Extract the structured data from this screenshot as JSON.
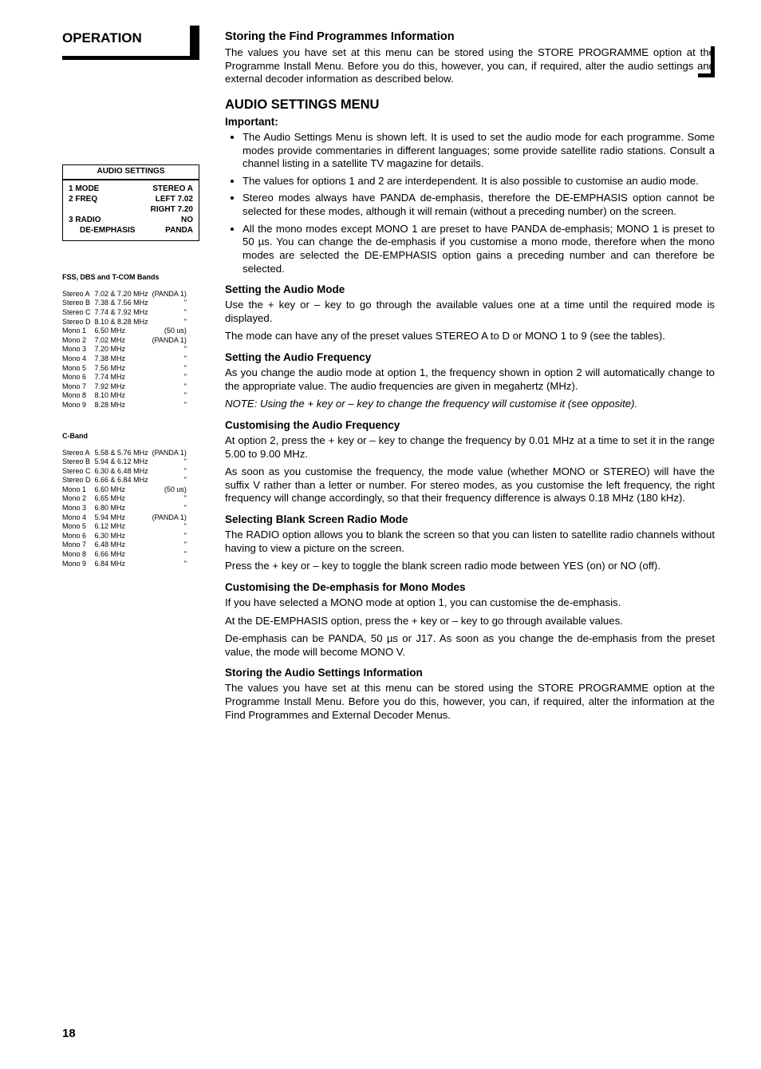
{
  "operation_title": "OPERATION",
  "menu_box": {
    "title": "AUDIO SETTINGS",
    "rows": [
      {
        "n": "1",
        "l": "MODE",
        "r": "STEREO A"
      },
      {
        "n": "2",
        "l": "FREQ",
        "r": "LEFT 7.02"
      },
      {
        "n": "",
        "l": "",
        "r": "RIGHT 7.20"
      },
      {
        "n": "3",
        "l": "RADIO",
        "r": "NO"
      },
      {
        "n": "",
        "l": "DE-EMPHASIS",
        "r": "PANDA",
        "indent": true
      }
    ]
  },
  "fss_head": "FSS, DBS and T-COM Bands",
  "fss_rows": [
    [
      "Stereo A",
      "7.02 & 7.20 MHz",
      "(PANDA 1)"
    ],
    [
      "Stereo B",
      "7.38 & 7.56 MHz",
      "\""
    ],
    [
      "Stereo C",
      "7.74 & 7.92 MHz",
      "\""
    ],
    [
      "Stereo D",
      "8.10 & 8.28 MHz",
      "\""
    ],
    [
      "Mono 1",
      "6.50 MHz",
      "(50 us)"
    ],
    [
      "Mono 2",
      "7.02 MHz",
      "(PANDA 1)"
    ],
    [
      "Mono 3",
      "7.20 MHz",
      "\""
    ],
    [
      "Mono 4",
      "7.38 MHz",
      "\""
    ],
    [
      "Mono 5",
      "7.56 MHz",
      "\""
    ],
    [
      "Mono 6",
      "7.74 MHz",
      "\""
    ],
    [
      "Mono 7",
      "7.92 MHz",
      "\""
    ],
    [
      "Mono 8",
      "8.10 MHz",
      "\""
    ],
    [
      "Mono 9",
      "8.28 MHz",
      "\""
    ]
  ],
  "cband_head": "C-Band",
  "cband_rows": [
    [
      "Stereo A",
      "5.58 & 5.76 MHz",
      "(PANDA 1)"
    ],
    [
      "Stereo B",
      "5.94 & 6.12 MHz",
      "\""
    ],
    [
      "Stereo C",
      "6.30 & 6.48 MHz",
      "\""
    ],
    [
      "Stereo D",
      "6.66 & 6.84 MHz",
      "\""
    ],
    [
      "Mono 1",
      "6.60 MHz",
      "(50 us)"
    ],
    [
      "Mono 2",
      "6.65 MHz",
      "\""
    ],
    [
      "Mono 3",
      "6.80 MHz",
      "\""
    ],
    [
      "Mono 4",
      "5.94 MHz",
      "(PANDA 1)"
    ],
    [
      "Mono 5",
      "6.12 MHz",
      "\""
    ],
    [
      "Mono 6",
      "6.30 MHz",
      "\""
    ],
    [
      "Mono 7",
      "6.48 MHz",
      "\""
    ],
    [
      "Mono 8",
      "6.66 MHz",
      "\""
    ],
    [
      "Mono 9",
      "6.84 MHz",
      "\""
    ]
  ],
  "right": {
    "h1": "Storing the Find Programmes Information",
    "p1": "The values you have set at this menu can be stored using the STORE PROGRAMME option at the Programme Install Menu. Before you do this, however, you can, if required, alter the audio settings and external decoder information as described below.",
    "h2": "AUDIO SETTINGS MENU",
    "imp": "Important:",
    "bul": [
      "The Audio Settings Menu is shown left. It is used to set the audio mode for each programme. Some modes provide commentaries in different languages; some provide satellite radio stations. Consult a channel listing in a satellite TV magazine for details.",
      "The values for options 1 and 2 are interdependent. It is also possible to customise an audio mode.",
      "Stereo modes always have PANDA de-emphasis, therefore the DE-EMPHASIS option cannot be selected for these modes, although it will remain (without a preceding number) on the screen.",
      "All the mono modes except MONO 1 are preset to have PANDA de-emphasis; MONO 1 is preset to 50 µs. You can change the de-emphasis if you customise a mono mode, therefore when the mono modes are selected the DE-EMPHASIS option gains a preceding number and can therefore be selected."
    ],
    "s1": "Setting the Audio Mode",
    "s1p1": "Use the + key or – key to go through the available values one at a time until the required mode is displayed.",
    "s1p2": "The mode can have any of the preset values STEREO A to D or MONO 1 to 9 (see the tables).",
    "s2": "Setting the Audio Frequency",
    "s2p1": "As you change the audio mode at option 1, the frequency shown in option 2 will automatically change to the appropriate value. The audio frequencies are given in megahertz (MHz).",
    "s2note": "NOTE: Using the + key or – key to change the frequency will customise it (see opposite).",
    "s3": "Customising the Audio Frequency",
    "s3p1": "At option 2, press the + key or – key to change the frequency by 0.01 MHz at a time to set it in the range 5.00 to 9.00 MHz.",
    "s3p2": "As soon as you customise the frequency, the mode value (whether MONO or STEREO) will have the suffix V rather than a letter or number. For stereo modes, as you customise the left frequency, the right frequency will change accordingly, so that their frequency difference is always 0.18 MHz (180 kHz).",
    "s4": "Selecting Blank Screen Radio Mode",
    "s4p1": "The RADIO option allows you to blank the screen so that you can listen to satellite radio channels without having to view a picture on the screen.",
    "s4p2": "Press the + key or – key to toggle the blank screen radio mode between YES (on) or NO (off).",
    "s5": "Customising the De-emphasis for Mono Modes",
    "s5p1": "If you have selected a MONO mode at option 1, you can customise the de-emphasis.",
    "s5p2": "At the DE-EMPHASIS option, press the + key or – key to go through available values.",
    "s5p3": "De-emphasis can be PANDA, 50 µs or J17. As soon as you change the de-emphasis from the preset value, the mode will become MONO V.",
    "s6": "Storing the Audio Settings Information",
    "s6p1": "The values you have set at this menu can be stored using the STORE PROGRAMME option at the Programme Install Menu. Before you do this, however, you can, if required, alter the information at the Find Programmes and External Decoder Menus."
  },
  "page_num": "18"
}
